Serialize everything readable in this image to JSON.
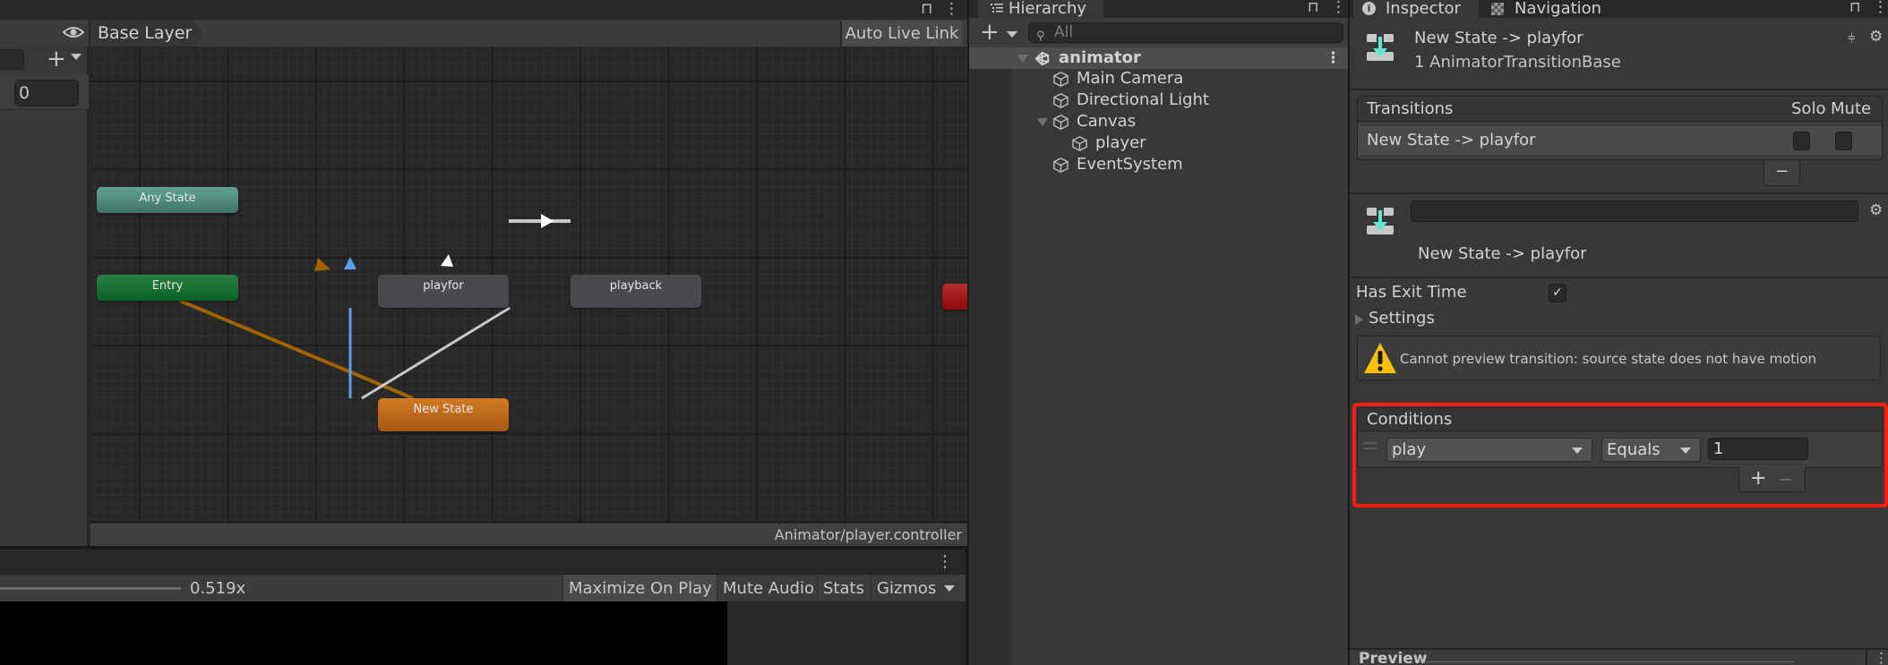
{
  "animator": {
    "layer_breadcrumb": "Base Layer",
    "auto_live_link_label": "Auto Live Link",
    "param_value": "0",
    "controller_path": "Animator/player.controller",
    "nodes": {
      "any_state": "Any State",
      "entry": "Entry",
      "playfor": "playfor",
      "playback": "playback",
      "new_state": "New State"
    },
    "colors": {
      "default_transition": "#a16200",
      "selected_transition": "#5aa0f0",
      "transition": "#c8c8c8"
    }
  },
  "game_view": {
    "scale_value": "0.519x",
    "buttons": {
      "maximize": "Maximize On Play",
      "mute": "Mute Audio",
      "stats": "Stats",
      "gizmos": "Gizmos"
    }
  },
  "hierarchy": {
    "tab_label": "Hierarchy",
    "search_placeholder": "All",
    "scene": "animator",
    "items": [
      {
        "label": "Main Camera"
      },
      {
        "label": "Directional Light"
      },
      {
        "label": "Canvas"
      },
      {
        "label": "player"
      },
      {
        "label": "EventSystem"
      }
    ]
  },
  "inspector": {
    "tab_label": "Inspector",
    "nav_tab_label": "Navigation",
    "header_title": "New State -> playfor",
    "header_subtitle": "1 AnimatorTransitionBase",
    "transitions": {
      "heading": "Transitions",
      "solo_label": "Solo",
      "mute_label": "Mute",
      "rows": [
        {
          "label": "New State -> playfor",
          "solo": false,
          "mute": false
        }
      ],
      "remove_label": "−"
    },
    "transition_name_value": "",
    "transition_title": "New State -> playfor",
    "has_exit_time_label": "Has Exit Time",
    "has_exit_time_checked": "✓",
    "settings_label": "Settings",
    "warning_text": "Cannot preview transition: source state does not have motion",
    "conditions": {
      "heading": "Conditions",
      "parameter": "play",
      "operator": "Equals",
      "value": "1",
      "add_label": "+",
      "remove_label": "−"
    },
    "preview_label": "Preview",
    "highlight_color": "#ff1e10"
  }
}
